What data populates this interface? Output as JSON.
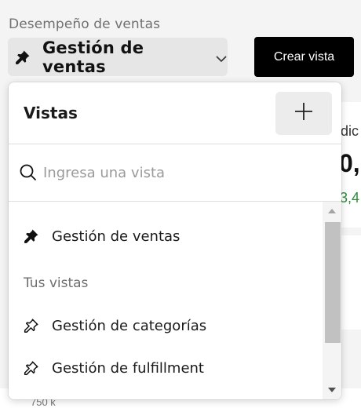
{
  "header": {
    "page_label": "Desempeño de ventas",
    "selector_label": "Gestión de ventas",
    "create_button": "Crear vista"
  },
  "background": {
    "metric_label_fragment": "edic",
    "metric_value_fragment": "0,",
    "metric_delta_fragment": "3,4",
    "axis_tick": "750 k"
  },
  "popover": {
    "title": "Vistas",
    "search": {
      "placeholder": "Ingresa una vista",
      "value": ""
    },
    "pinned": [
      {
        "label": "Gestión de ventas"
      }
    ],
    "section_label": "Tus vistas",
    "items": [
      {
        "label": "Gestión de categorías"
      },
      {
        "label": "Gestión de fulfillment"
      }
    ]
  },
  "icons": {
    "pin": "pin-filled-icon",
    "pin_outline": "pin-outline-icon",
    "chevron": "chevron-down-icon",
    "plus": "plus-icon",
    "search": "search-icon"
  },
  "colors": {
    "primary_button": "#000000",
    "positive": "#2f8a3c"
  }
}
